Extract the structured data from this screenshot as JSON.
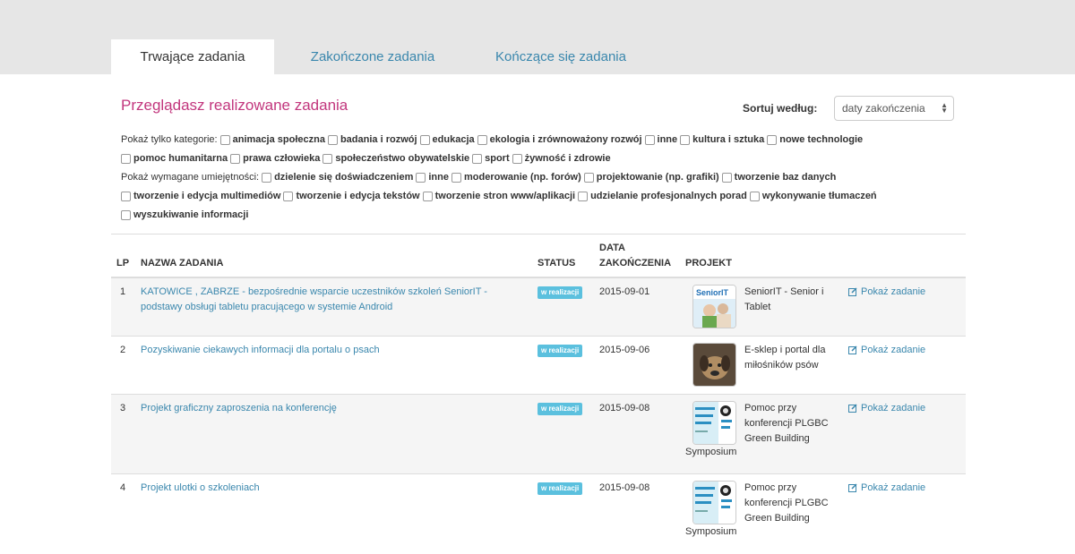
{
  "tabs": [
    {
      "label": "Trwające zadania",
      "active": true
    },
    {
      "label": "Zakończone zadania",
      "active": false
    },
    {
      "label": "Kończące się zadania",
      "active": false
    }
  ],
  "heading": "Przeglądasz realizowane zadania",
  "sort": {
    "label": "Sortuj według:",
    "value": "daty zakończenia"
  },
  "filters": {
    "categories_label": "Pokaż tylko kategorie:",
    "categories": [
      "animacja społeczna",
      "badania i rozwój",
      "edukacja",
      "ekologia i zrównoważony rozwój",
      "inne",
      "kultura i sztuka",
      "nowe technologie",
      "pomoc humanitarna",
      "prawa człowieka",
      "społeczeństwo obywatelskie",
      "sport",
      "żywność i zdrowie"
    ],
    "skills_label": "Pokaż wymagane umiejętności:",
    "skills": [
      "dzielenie się doświadczeniem",
      "inne",
      "moderowanie (np. forów)",
      "projektowanie (np. grafiki)",
      "tworzenie baz danych",
      "tworzenie i edycja multimediów",
      "tworzenie i edycja tekstów",
      "tworzenie stron www/aplikacji",
      "udzielanie profesjonalnych porad",
      "wykonywanie tłumaczeń",
      "wyszukiwanie informacji"
    ]
  },
  "table": {
    "headers": {
      "lp": "LP",
      "name": "NAZWA ZADANIA",
      "status": "STATUS",
      "date_line1": "DATA",
      "date_line2": "ZAKOŃCZENIA",
      "project": "PROJEKT"
    },
    "show_label": "Pokaż zadanie",
    "rows": [
      {
        "lp": "1",
        "task": "KATOWICE , ZABRZE - bezpośrednie wsparcie uczestników szkoleń SeniorIT - podstawy obsługi tabletu pracującego w systemie Android",
        "status": "w realizacji",
        "date": "2015-09-01",
        "project": "SeniorIT - Senior i Tablet",
        "symposium": ""
      },
      {
        "lp": "2",
        "task": "Pozyskiwanie ciekawych informacji dla portalu o psach",
        "status": "w realizacji",
        "date": "2015-09-06",
        "project": "E-sklep i portal dla miłośników psów",
        "symposium": ""
      },
      {
        "lp": "3",
        "task": "Projekt graficzny zaproszenia na konferencję",
        "status": "w realizacji",
        "date": "2015-09-08",
        "project": "Pomoc przy konferencji PLGBC Green Building",
        "symposium": "Symposium"
      },
      {
        "lp": "4",
        "task": "Projekt ulotki o szkoleniach",
        "status": "w realizacji",
        "date": "2015-09-08",
        "project": "Pomoc przy konferencji PLGBC Green Building",
        "symposium": "Symposium"
      }
    ]
  },
  "thumb_logo_text": "SeniorIT",
  "colors": {
    "accent": "#c2367d",
    "link": "#3a87ad",
    "badge": "#5bc0de",
    "topbar": "#e6e6e6"
  }
}
